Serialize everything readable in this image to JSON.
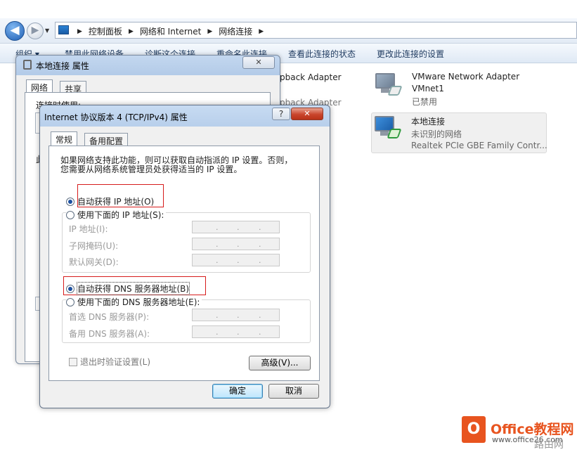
{
  "nav": {
    "back_glyph": "◀",
    "forward_glyph": "▶",
    "breadcrumbs": [
      "控制面板",
      "网络和 Internet",
      "网络连接"
    ]
  },
  "toolbar": {
    "organize": "组织 ▾",
    "disable": "禁用此网络设备",
    "diagnose": "诊断这个连接",
    "rename": "重命名此连接",
    "view_status": "查看此连接的状态",
    "change_settings": "更改此连接的设置"
  },
  "connections": {
    "loopback1": "pback Adapter",
    "loopback2": "pback Adapter",
    "vmware": {
      "name": "VMware Network Adapter",
      "name2": "VMnet1",
      "status": "已禁用"
    },
    "local": {
      "name": "本地连接",
      "status": "未识别的网络",
      "device": "Realtek PCIe GBE Family Contr..."
    }
  },
  "back_dialog": {
    "title": "本地连接 属性",
    "close": "✕",
    "tabs": [
      "网络",
      "共享"
    ],
    "connect_using": "连接时使用:",
    "partial": "此"
  },
  "dialog": {
    "title": "Internet 协议版本 4 (TCP/IPv4) 属性",
    "help": "?",
    "close": "✕",
    "tabs": [
      "常规",
      "备用配置"
    ],
    "description": "如果网络支持此功能，则可以获取自动指派的 IP 设置。否则，\n您需要从网络系统管理员处获得适当的 IP 设置。",
    "auto_ip": "自动获得 IP 地址(O)",
    "manual_ip": "使用下面的 IP 地址(S):",
    "ip_label": "IP 地址(I):",
    "mask_label": "子网掩码(U):",
    "gateway_label": "默认网关(D):",
    "auto_dns": "自动获得 DNS 服务器地址(B)",
    "manual_dns": "使用下面的 DNS 服务器地址(E):",
    "pref_dns_label": "首选 DNS 服务器(P):",
    "alt_dns_label": "备用 DNS 服务器(A):",
    "ip_dot": ".",
    "validate_exit": "退出时验证设置(L)",
    "advanced": "高级(V)...",
    "ok": "确定",
    "cancel": "取消"
  },
  "watermark": {
    "logo_glyph": "O",
    "brand": "Office教程网",
    "url": "www.office26.com",
    "extra": "路由网"
  }
}
